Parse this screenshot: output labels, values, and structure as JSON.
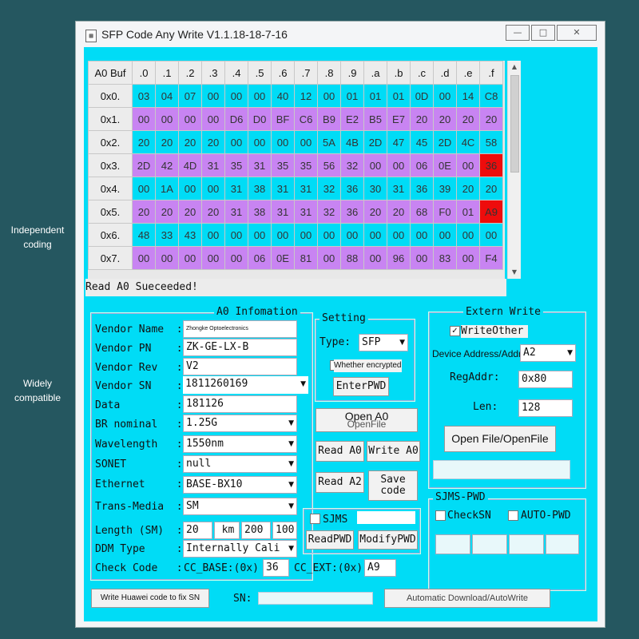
{
  "side_labels": {
    "left_top_1": "Independent",
    "left_top_2": "coding",
    "left_bottom_1": "Widely",
    "left_bottom_2": "compatible"
  },
  "window": {
    "title": "SFP Code Any Write V1.1.18-18-7-16",
    "minimize": "—",
    "maximize": "□",
    "close": "✕"
  },
  "grid": {
    "corner": "A0 Buf",
    "columns": [
      ".0",
      ".1",
      ".2",
      ".3",
      ".4",
      ".5",
      ".6",
      ".7",
      ".8",
      ".9",
      ".a",
      ".b",
      ".c",
      ".d",
      ".e",
      ".f"
    ],
    "rows": [
      {
        "label": "0x0.",
        "color": "cyan",
        "cells": [
          "03",
          "04",
          "07",
          "00",
          "00",
          "00",
          "40",
          "12",
          "00",
          "01",
          "01",
          "01",
          "0D",
          "00",
          "14",
          "C8"
        ]
      },
      {
        "label": "0x1.",
        "color": "magenta",
        "cells": [
          "00",
          "00",
          "00",
          "00",
          "D6",
          "D0",
          "BF",
          "C6",
          "B9",
          "E2",
          "B5",
          "E7",
          "20",
          "20",
          "20",
          "20"
        ]
      },
      {
        "label": "0x2.",
        "color": "cyan",
        "cells": [
          "20",
          "20",
          "20",
          "20",
          "00",
          "00",
          "00",
          "00",
          "5A",
          "4B",
          "2D",
          "47",
          "45",
          "2D",
          "4C",
          "58"
        ]
      },
      {
        "label": "0x3.",
        "color": "magenta",
        "cells": [
          "2D",
          "42",
          "4D",
          "31",
          "35",
          "31",
          "35",
          "35",
          "56",
          "32",
          "00",
          "00",
          "06",
          "0E",
          "00",
          "36"
        ]
      },
      {
        "label": "0x4.",
        "color": "cyan",
        "cells": [
          "00",
          "1A",
          "00",
          "00",
          "31",
          "38",
          "31",
          "31",
          "32",
          "36",
          "30",
          "31",
          "36",
          "39",
          "20",
          "20"
        ]
      },
      {
        "label": "0x5.",
        "color": "magenta",
        "cells": [
          "20",
          "20",
          "20",
          "20",
          "31",
          "38",
          "31",
          "31",
          "32",
          "36",
          "20",
          "20",
          "68",
          "F0",
          "01",
          "A9"
        ]
      },
      {
        "label": "0x6.",
        "color": "cyan",
        "cells": [
          "48",
          "33",
          "43",
          "00",
          "00",
          "00",
          "00",
          "00",
          "00",
          "00",
          "00",
          "00",
          "00",
          "00",
          "00",
          "00"
        ]
      },
      {
        "label": "0x7.",
        "color": "magenta",
        "cells": [
          "00",
          "00",
          "00",
          "00",
          "00",
          "06",
          "0E",
          "81",
          "00",
          "88",
          "00",
          "96",
          "00",
          "83",
          "00",
          "F4"
        ]
      }
    ],
    "highlight_color": "#ee0c0c",
    "cyan_color": "#00dcf6",
    "magenta_color": "#c884f2"
  },
  "status": "Read A0 Sueceeded!",
  "a0info": {
    "title": "A0 Infomation",
    "vendor_name_label": "Vendor Name  :",
    "vendor_name": "Zhongke Optoelectronics",
    "vendor_pn_label": "Vendor PN    :",
    "vendor_pn": "ZK-GE-LX-B",
    "vendor_rev_label": "Vendor Rev   :",
    "vendor_rev": "V2",
    "vendor_sn_label": "Vendor SN    :",
    "vendor_sn": "1811260169",
    "data_label": "Data         :",
    "data": "181126",
    "br_label": "BR nominal   :",
    "br": "1.25G",
    "wavelength_label": "Wavelength   :",
    "wavelength": "1550nm",
    "sonet_label": "SONET        :",
    "sonet": "null",
    "ethernet_label": "Ethernet     :",
    "ethernet": "BASE-BX10",
    "trans_label": "Trans-Media  :",
    "trans": "SM",
    "length_label": "Length (SM)  :",
    "length_value": "20",
    "length_unit": "km",
    "length_2": "200",
    "length_3": "100",
    "ddm_label": "DDM Type     :",
    "ddm": "Internally Cali",
    "check_label": "Check Code   :",
    "cc_base_label": "CC_BASE:(0x)",
    "cc_base": "36",
    "cc_ext_label": "CC_EXT:(0x)",
    "cc_ext": "A9"
  },
  "setting": {
    "title": "Setting",
    "type_label": "Type:",
    "type_value": "SFP",
    "encrypted_label": "Whether encrypted",
    "enter_pwd": "EnterPWD"
  },
  "buttons": {
    "open_a0": "Open A0",
    "open_file_sub": "OpenFile",
    "read_a0": "Read A0",
    "write_a0": "Write A0",
    "read_a2": "Read A2",
    "save_code_1": "Save",
    "save_code_2": "code"
  },
  "sjms_small": {
    "sjms_label": "SJMS",
    "read_pwd": "ReadPWD",
    "modify_pwd": "ModifyPWD"
  },
  "extern": {
    "title": "Extern Write",
    "write_other": "WriteOther",
    "device_addr_label": "Device Address/Addr",
    "device_addr": "A2",
    "regaddr_label": "RegAddr:",
    "regaddr": "0x80",
    "len_label": "Len:",
    "len": "128",
    "open_file": "Open File/OpenFile"
  },
  "sjms_pwd": {
    "title": "SJMS-PWD",
    "check_sn": "CheckSN",
    "auto_pwd": "AUTO-PWD"
  },
  "bottom": {
    "huawei": "Write Huawei code to fix SN",
    "sn_label": "SN:",
    "auto_download": "Automatic Download/AutoWrite"
  }
}
